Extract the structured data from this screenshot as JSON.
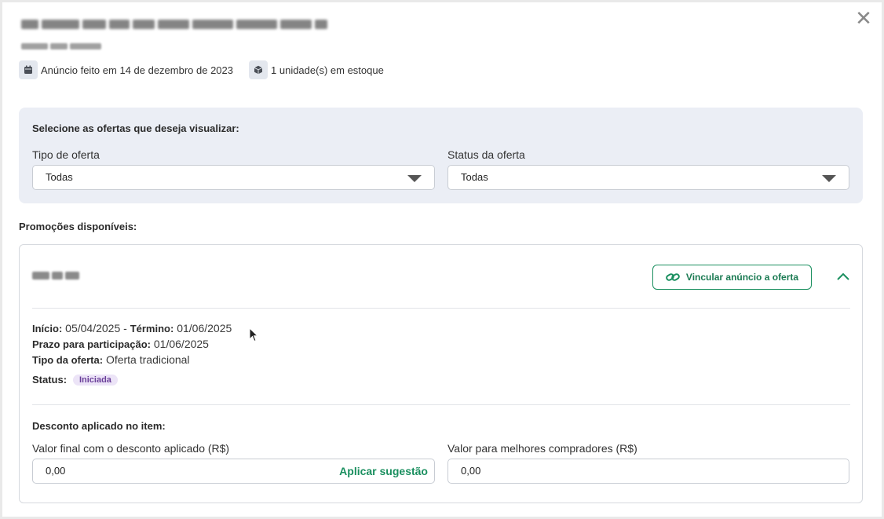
{
  "header": {
    "close_icon": "close-icon",
    "listed_label": "Anúncio feito em 14 de dezembro de 2023",
    "stock_label": "1 unidade(s) em estoque"
  },
  "filters": {
    "title": "Selecione as ofertas que deseja visualizar:",
    "offer_type_label": "Tipo de oferta",
    "offer_type_value": "Todas",
    "offer_status_label": "Status da oferta",
    "offer_status_value": "Todas"
  },
  "promotions": {
    "section_title": "Promoções disponíveis:",
    "card": {
      "link_button_label": "Vincular anúncio a oferta",
      "start_label": "Início:",
      "start_value": "05/04/2025",
      "separator": "-",
      "end_label": "Término:",
      "end_value": "01/06/2025",
      "deadline_label": "Prazo para participação:",
      "deadline_value": "01/06/2025",
      "type_label": "Tipo da oferta:",
      "type_value": "Oferta tradicional",
      "status_label": "Status:",
      "status_value": "Iniciada",
      "discount_title": "Desconto aplicado no item:",
      "final_value_label": "Valor final com o desconto aplicado (R$)",
      "final_value": "0,00",
      "apply_suggestion_label": "Aplicar sugestão",
      "best_buyers_label": "Valor para melhores compradores (R$)",
      "best_buyers_value": "0,00"
    }
  },
  "colors": {
    "accent_green": "#1a8f5f",
    "filter_bg": "#ebeef5",
    "badge_bg": "#ece4f7",
    "badge_text": "#6a3f99"
  }
}
